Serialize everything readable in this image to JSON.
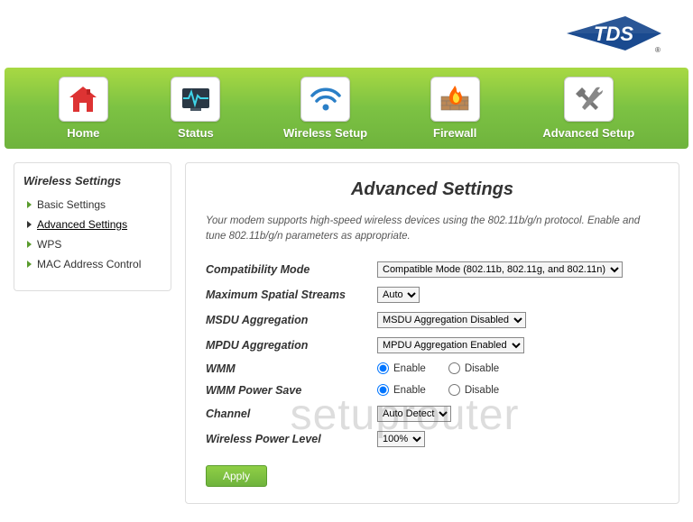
{
  "logo": {
    "text": "TDS"
  },
  "nav": {
    "items": [
      {
        "label": "Home"
      },
      {
        "label": "Status"
      },
      {
        "label": "Wireless Setup"
      },
      {
        "label": "Firewall"
      },
      {
        "label": "Advanced Setup"
      }
    ]
  },
  "sidebar": {
    "title": "Wireless Settings",
    "items": [
      {
        "label": "Basic Settings"
      },
      {
        "label": "Advanced Settings"
      },
      {
        "label": "WPS"
      },
      {
        "label": "MAC Address Control"
      }
    ]
  },
  "page": {
    "title": "Advanced Settings",
    "description": "Your modem supports high-speed wireless devices using the 802.11b/g/n protocol. Enable and tune 802.11b/g/n parameters as appropriate."
  },
  "form": {
    "compat_label": "Compatibility Mode",
    "compat_value": "Compatible Mode (802.11b, 802.11g, and 802.11n)",
    "spatial_label": "Maximum Spatial Streams",
    "spatial_value": "Auto",
    "msdu_label": "MSDU Aggregation",
    "msdu_value": "MSDU Aggregation Disabled",
    "mpdu_label": "MPDU Aggregation",
    "mpdu_value": "MPDU Aggregation Enabled",
    "wmm_label": "WMM",
    "wmm_enable": "Enable",
    "wmm_disable": "Disable",
    "wmmps_label": "WMM Power Save",
    "wmmps_enable": "Enable",
    "wmmps_disable": "Disable",
    "channel_label": "Channel",
    "channel_value": "Auto Detect",
    "power_label": "Wireless Power Level",
    "power_value": "100%",
    "apply_label": "Apply"
  },
  "watermark": "setuprouter"
}
